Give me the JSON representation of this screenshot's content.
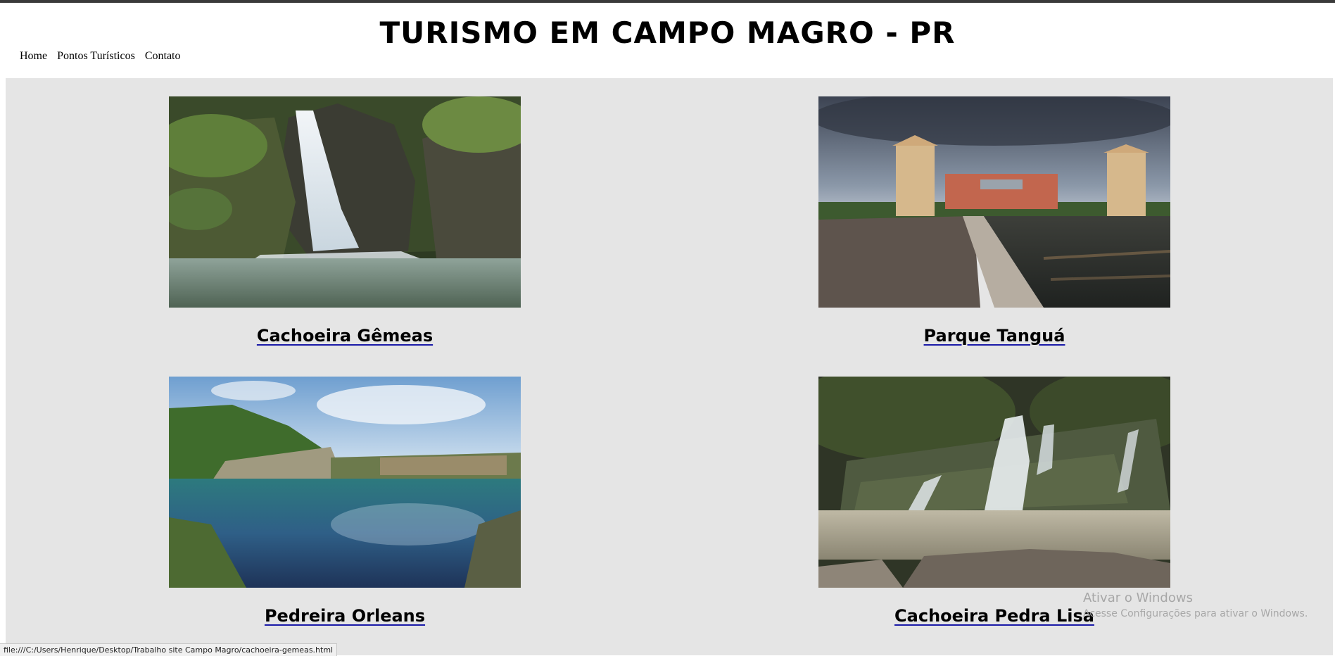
{
  "header": {
    "title": "TURISMO EM CAMPO MAGRO - PR"
  },
  "nav": {
    "items": [
      "Home",
      "Pontos Turísticos",
      "Contato"
    ]
  },
  "attractions": [
    {
      "name": "Cachoeira Gêmeas",
      "image": "waterfall-photo"
    },
    {
      "name": "Parque Tanguá",
      "image": "park-towers-photo"
    },
    {
      "name": "Pedreira Orleans",
      "image": "quarry-lake-photo"
    },
    {
      "name": "Cachoeira Pedra Lisa",
      "image": "cascade-photo"
    }
  ],
  "colors": {
    "content_bg": "#e5e5e5",
    "link_underline": "#1a1aa8"
  },
  "watermark": {
    "line1": "Ativar o Windows",
    "line2": "Acesse Configurações para ativar o Windows."
  },
  "status_bar": {
    "url": "file:///C:/Users/Henrique/Desktop/Trabalho site Campo Magro/cachoeira-gemeas.html"
  }
}
